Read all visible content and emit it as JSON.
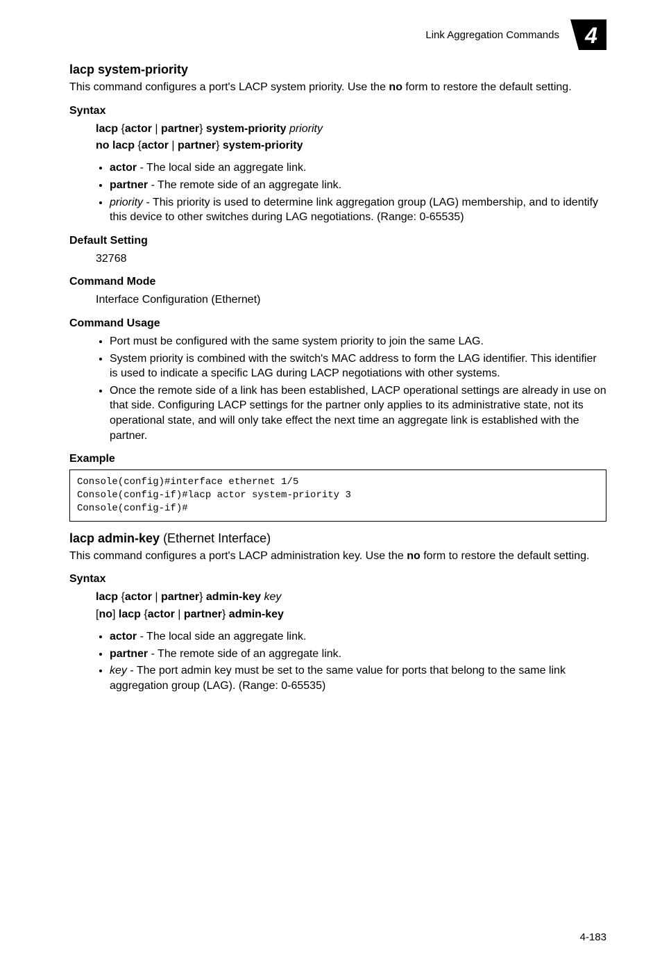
{
  "header": {
    "running_title": "Link Aggregation Commands",
    "chapter_number": "4"
  },
  "section1": {
    "title": "lacp system-priority",
    "intro_before_no": "This command configures a port's LACP system priority. Use the ",
    "no_word": "no",
    "intro_after_no": " form to restore the default setting.",
    "syntax_head": "Syntax",
    "syntax_line1": {
      "lacp": "lacp",
      "brace_open": " {",
      "actor": "actor",
      "pipe": " | ",
      "partner": "partner",
      "brace_close": "} ",
      "sp": "system-priority",
      "space": " ",
      "priority": "priority"
    },
    "syntax_line2": {
      "nolacp": "no lacp",
      "brace_open": " {",
      "actor": "actor",
      "pipe": " | ",
      "partner": "partner",
      "brace_close": "} ",
      "sp": "system-priority"
    },
    "bullets1": {
      "actor_label": "actor",
      "actor_text": " - The local side an aggregate link.",
      "partner_label": "partner",
      "partner_text": " - The remote side of an aggregate link.",
      "priority_label": "priority",
      "priority_text": " - This priority is used to determine link aggregation group (LAG) membership, and to identify this device to other switches during LAG negotiations. (Range: 0-65535)"
    },
    "default_head": "Default Setting",
    "default_value": "32768",
    "mode_head": "Command Mode",
    "mode_value": "Interface Configuration (Ethernet)",
    "usage_head": "Command Usage",
    "usage_bullets": [
      "Port must be configured with the same system priority to join the same LAG.",
      "System priority is combined with the switch's MAC address to form the LAG identifier. This identifier is used to indicate a specific LAG during LACP negotiations with other systems.",
      "Once the remote side of a link has been established, LACP operational settings are already in use on that side. Configuring LACP settings for the partner only applies to its administrative state, not its operational state, and will only take effect the next time an aggregate link is established with the partner."
    ],
    "example_head": "Example",
    "example_code": "Console(config)#interface ethernet 1/5\nConsole(config-if)#lacp actor system-priority 3\nConsole(config-if)#"
  },
  "section2": {
    "title_bold": "lacp admin-key",
    "title_rest": " (Ethernet Interface)",
    "intro_before_no": "This command configures a port's LACP administration key. Use the ",
    "no_word": "no",
    "intro_after_no": " form to restore the default setting.",
    "syntax_head": "Syntax",
    "syntax_line1": {
      "lacp": "lacp",
      "brace_open": " {",
      "actor": "actor",
      "pipe": " | ",
      "partner": "partner",
      "brace_close": "} ",
      "ak": "admin-key",
      "space": " ",
      "key": "key"
    },
    "syntax_line2": {
      "open": "[",
      "no": "no",
      "close": "] ",
      "lacp": "lacp",
      "brace_open": " {",
      "actor": "actor",
      "pipe": " | ",
      "partner": "partner",
      "brace_close": "} ",
      "ak": "admin-key"
    },
    "bullets1": {
      "actor_label": "actor",
      "actor_text": " - The local side an aggregate link.",
      "partner_label": "partner",
      "partner_text": " - The remote side of an aggregate link.",
      "key_label": "key",
      "key_text": " - The port admin key must be set to the same value for ports that belong to the same link aggregation group (LAG). (Range: 0-65535)"
    }
  },
  "footer": {
    "page_number": "4-183"
  }
}
